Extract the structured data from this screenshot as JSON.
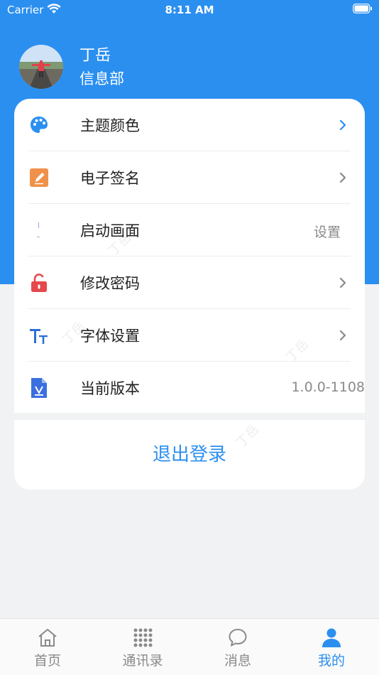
{
  "status_bar": {
    "carrier": "Carrier",
    "time": "8:11 AM"
  },
  "profile": {
    "name": "丁岳",
    "department": "信息部"
  },
  "menu": [
    {
      "label": "主题颜色",
      "icon": "palette-icon",
      "accessory": "chevron"
    },
    {
      "label": "电子签名",
      "icon": "pen-icon",
      "accessory": "chevron"
    },
    {
      "label": "启动画面",
      "icon": "launch-screen-icon",
      "accessory": "text",
      "value": "设置"
    },
    {
      "label": "修改密码",
      "icon": "lock-icon",
      "accessory": "chevron"
    },
    {
      "label": "字体设置",
      "icon": "font-icon",
      "accessory": "chevron"
    },
    {
      "label": "当前版本",
      "icon": "version-file-icon",
      "accessory": "text",
      "value": "1.0.0-1108"
    }
  ],
  "logout_label": "退出登录",
  "watermark": "丁岳",
  "tabs": [
    {
      "label": "首页",
      "icon": "home-icon",
      "active": false
    },
    {
      "label": "通讯录",
      "icon": "grid-icon",
      "active": false
    },
    {
      "label": "消息",
      "icon": "chat-icon",
      "active": false
    },
    {
      "label": "我的",
      "icon": "user-icon",
      "active": true
    }
  ],
  "colors": {
    "primary": "#2b8ff0",
    "background": "#f1f2f4"
  }
}
